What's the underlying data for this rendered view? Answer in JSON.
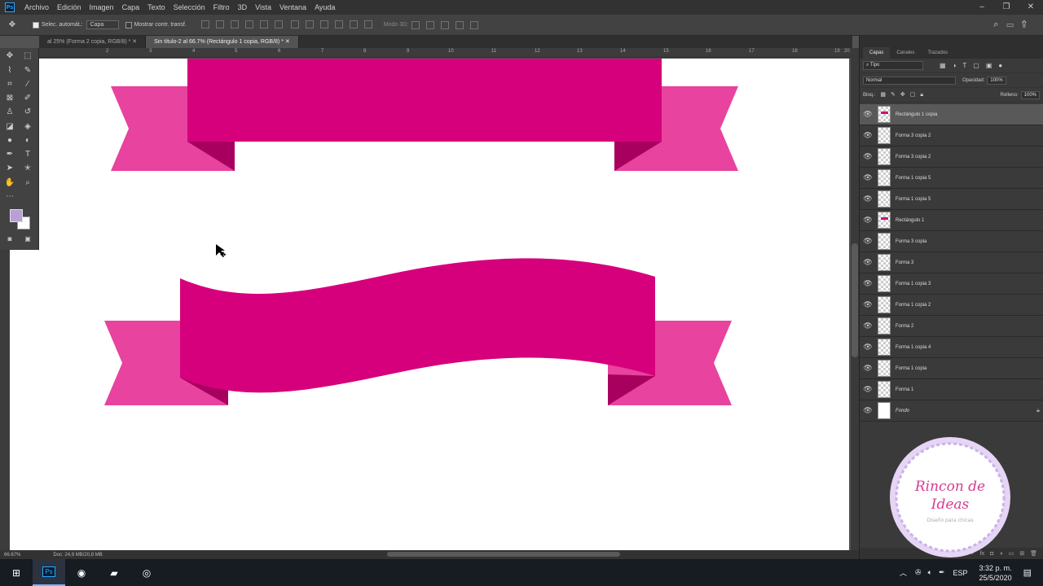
{
  "menubar": {
    "items": [
      "Archivo",
      "Edición",
      "Imagen",
      "Capa",
      "Texto",
      "Selección",
      "Filtro",
      "3D",
      "Vista",
      "Ventana",
      "Ayuda"
    ],
    "ps_label": "Ps"
  },
  "options": {
    "auto_select_label": "Selec. automát.:",
    "auto_select_value": "Capa",
    "show_transform_label": "Mostrar contr. transf.",
    "mode3d_label": "Modo 3D:"
  },
  "tabs": [
    {
      "label": "al 25% (Forma 2 copia, RGB/8) *"
    },
    {
      "label": "Sin título-2 al 66.7% (Rectángulo 1 copia, RGB/8) *"
    }
  ],
  "ruler_numbers": [
    "2",
    "3",
    "4",
    "5",
    "6",
    "7",
    "8",
    "9",
    "10",
    "11",
    "12",
    "13",
    "14",
    "15",
    "16",
    "17",
    "18",
    "19",
    "20"
  ],
  "panel": {
    "tabs": [
      "Capas",
      "Canales",
      "Trazados"
    ],
    "filter_label": "Tipo",
    "blend_mode": "Normal",
    "opacity_label": "Opacidad:",
    "opacity_value": "100%",
    "lock_label": "Bloq.:",
    "fill_label": "Relleno:",
    "fill_value": "100%",
    "layers": [
      {
        "name": "Rectángulo 1 copia",
        "active": true,
        "mark": true
      },
      {
        "name": "Forma 3 copia 2"
      },
      {
        "name": "Forma 3 copia 2"
      },
      {
        "name": "Forma 1 copia 5"
      },
      {
        "name": "Forma 1 copia 5"
      },
      {
        "name": "Rectángulo 1",
        "mark": true
      },
      {
        "name": "Forma 3 copia"
      },
      {
        "name": "Forma 3"
      },
      {
        "name": "Forma 1 copia 3"
      },
      {
        "name": "Forma 1 copia 2"
      },
      {
        "name": "Forma 2"
      },
      {
        "name": "Forma 1 copia 4"
      },
      {
        "name": "Forma 1 copia"
      },
      {
        "name": "Forma 1"
      },
      {
        "name": "Fondo",
        "background": true
      }
    ]
  },
  "status": {
    "zoom": "66.67%",
    "doc": "Doc: 24,9 MB/20,8 MB"
  },
  "watermark": {
    "title": "Rincon de Ideas",
    "subtitle": "Diseño para chicas"
  },
  "taskbar": {
    "lang": "ESP",
    "time": "3:32 p. m.",
    "date": "25/5/2020"
  },
  "colors": {
    "ribbon_main": "#d6007c",
    "ribbon_ends": "#e8439e",
    "ribbon_fold": "#a8005f",
    "foreground": "#b89fd6"
  }
}
